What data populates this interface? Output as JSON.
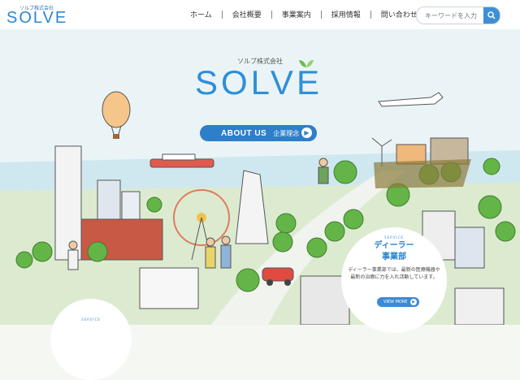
{
  "header": {
    "logo_sub": "ソルブ株式会社",
    "logo_main": "SOLVE",
    "nav": [
      "ホーム",
      "会社概要",
      "事業案内",
      "採用情報",
      "問い合わせ"
    ],
    "search_placeholder": "キーワードを入力",
    "search_icon": "search-icon"
  },
  "hero": {
    "brand_sub": "ソルブ株式会社",
    "brand_main": "SOLVE",
    "about_en": "ABOUT US",
    "about_jp": "企業理念",
    "about_icon": "arrow-right-icon"
  },
  "dealer_card": {
    "tag": "SERVICE",
    "title_line1": "ディーラー",
    "title_line2": "事業部",
    "desc": "ディーラー事業部では、最新の医療機器や最新の治療に力を入れ活動しています。",
    "button": "VIEW MORE",
    "button_icon": "arrow-right-icon"
  },
  "partial_card": {
    "tag": "SERVICE"
  },
  "colors": {
    "accent": "#2f7ec9",
    "logo": "#2c86d2",
    "sky": "#e8f3f7",
    "grass": "#c9e6a6",
    "tree": "#64b548"
  }
}
